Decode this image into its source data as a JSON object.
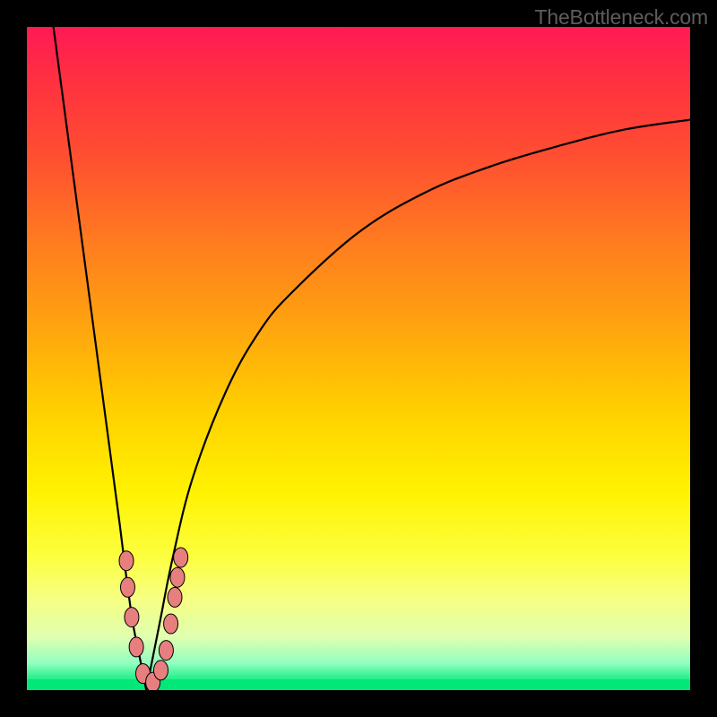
{
  "watermark": "TheBottleneck.com",
  "chart_data": {
    "type": "line",
    "title": "",
    "xlabel": "",
    "ylabel": "",
    "xlim": [
      0,
      100
    ],
    "ylim": [
      0,
      100
    ],
    "legend": false,
    "grid": false,
    "background_gradient": {
      "top": "#ff1a55",
      "mid": "#ffd000",
      "bottom": "#00e878"
    },
    "series": [
      {
        "name": "bottleneck-curve-left",
        "x": [
          4,
          6,
          8,
          10,
          12,
          14,
          15,
          16,
          17,
          18
        ],
        "values": [
          100,
          85,
          70,
          55,
          40,
          25,
          17,
          10,
          5,
          0
        ]
      },
      {
        "name": "bottleneck-curve-right",
        "x": [
          18,
          20,
          22,
          25,
          30,
          35,
          40,
          50,
          60,
          70,
          80,
          90,
          100
        ],
        "values": [
          0,
          10,
          20,
          32,
          45,
          54,
          60,
          69,
          75,
          79,
          82,
          84.5,
          86
        ]
      }
    ],
    "markers": [
      {
        "x": 15.0,
        "y": 19.5
      },
      {
        "x": 15.2,
        "y": 15.5
      },
      {
        "x": 15.8,
        "y": 11.0
      },
      {
        "x": 16.5,
        "y": 6.5
      },
      {
        "x": 17.5,
        "y": 2.5
      },
      {
        "x": 19.0,
        "y": 1.2
      },
      {
        "x": 20.2,
        "y": 3.0
      },
      {
        "x": 21.0,
        "y": 6.0
      },
      {
        "x": 21.7,
        "y": 10.0
      },
      {
        "x": 22.3,
        "y": 14.0
      },
      {
        "x": 22.7,
        "y": 17.0
      },
      {
        "x": 23.2,
        "y": 20.0
      }
    ],
    "marker_color": "#e87f7f",
    "marker_stroke": "#000000"
  }
}
